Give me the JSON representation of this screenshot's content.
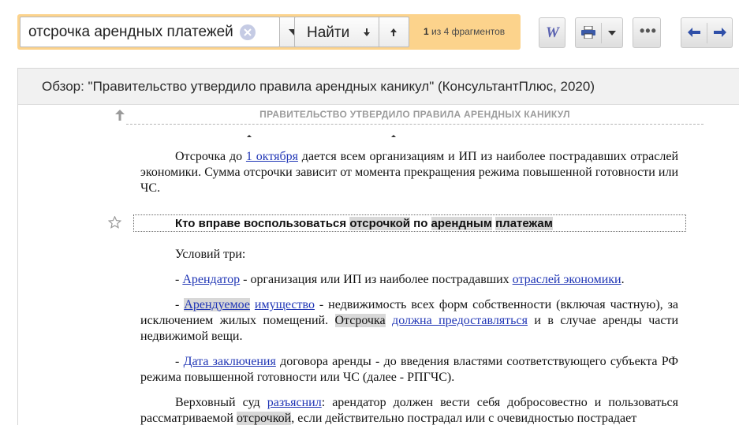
{
  "toolbar": {
    "search_value": "отсрочка арендных платежей",
    "find_label": "Найти",
    "counter_current": "1",
    "counter_rest": "из 4 фрагментов",
    "word_label": "W",
    "more_label": "•••"
  },
  "document": {
    "title": "Обзор: \"Правительство утвердило правила арендных каникул\" (КонсультантПлюс, 2020)",
    "section_caption": "ПРАВИТЕЛЬСТВО УТВЕРДИЛО ПРАВИЛА АРЕНДНЫХ КАНИКУЛ",
    "p1": {
      "a": "Отсрочка до ",
      "link": "1 октября",
      "b": " дается всем организациям и ИП из наиболее пострадавших отраслей экономики. Сумма отсрочки зависит от момента прекращения режима повышенной готовности или ЧС."
    },
    "heading": {
      "a": "Кто вправе воспользоваться ",
      "h1": "отсрочкой",
      "b": " по ",
      "h2": "арендным",
      "c": " ",
      "h3": "платежам"
    },
    "p2": "Условий три:",
    "p3": {
      "a": "- ",
      "link1": "Арендатор",
      "b": " - организация или ИП из наиболее пострадавших ",
      "link2": "отраслей экономики",
      "c": "."
    },
    "p4": {
      "a": "- ",
      "link1": "Арендуемое",
      "b": " ",
      "link2": "имущество",
      "c": " - недвижимость всех форм собственности (включая частную), за исключением жилых помещений. ",
      "hl": "Отсрочка",
      "d": " ",
      "link3": "должна предоставляться",
      "e": " и в случае аренды части недвижимой вещи."
    },
    "p5": {
      "a": "- ",
      "link": "Дата заключения",
      "b": " договора аренды - до введения властями соответствующего субъекта РФ режима повышенной готовности или ЧС (далее - РПГЧС)."
    },
    "p6": {
      "a": "Верховный суд ",
      "link": "разъяснил",
      "b": ": арендатор должен вести себя добросовестно и пользоваться рассматриваемой ",
      "hl": "отсрочкой",
      "c": ", если действительно пострадал или с очевидностью пострадает"
    }
  },
  "colors": {
    "search_panel": "#fcd38c",
    "link": "#1f35b5",
    "highlight": "#d8d8d8",
    "header_bg": "#f1f1f1"
  },
  "icons": [
    "clear-icon",
    "chevron-down-icon",
    "arrow-down-icon",
    "arrow-up-icon",
    "word-icon",
    "printer-icon",
    "more-icon",
    "arrow-left-icon",
    "arrow-right-icon",
    "star-icon",
    "scroll-up-icon"
  ]
}
